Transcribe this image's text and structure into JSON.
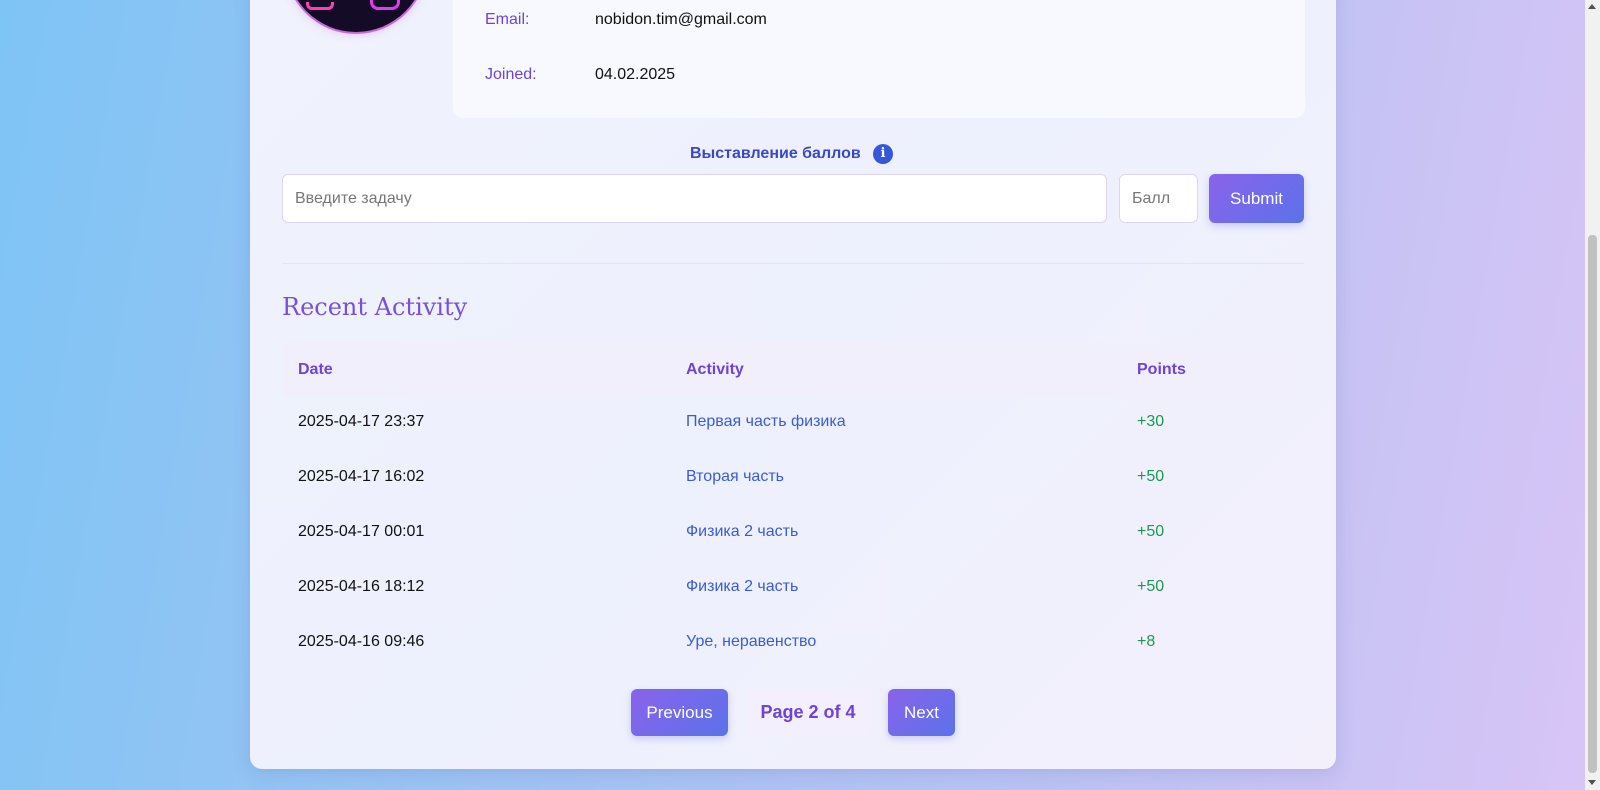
{
  "profile": {
    "email_label": "Email:",
    "email_value": "nobidon.tim@gmail.com",
    "joined_label": "Joined:",
    "joined_value": "04.02.2025"
  },
  "scoring": {
    "title": "Выставление баллов",
    "info_icon": "info-icon",
    "task_placeholder": "Введите задачу",
    "points_placeholder": "Балл",
    "submit_label": "Submit"
  },
  "activity": {
    "title": "Recent Activity",
    "columns": [
      "Date",
      "Activity",
      "Points"
    ],
    "rows": [
      {
        "date": "2025-04-17 23:37",
        "activity": "Первая часть физика",
        "points": "+30"
      },
      {
        "date": "2025-04-17 16:02",
        "activity": "Вторая часть",
        "points": "+50"
      },
      {
        "date": "2025-04-17 00:01",
        "activity": "Физика 2 часть",
        "points": "+50"
      },
      {
        "date": "2025-04-16 18:12",
        "activity": "Физика 2 часть",
        "points": "+50"
      },
      {
        "date": "2025-04-16 09:46",
        "activity": "Уре, неравенство",
        "points": "+8"
      }
    ]
  },
  "pagination": {
    "previous_label": "Previous",
    "page_info": "Page 2 of 4",
    "next_label": "Next"
  },
  "colors": {
    "accent": "#6d43d9",
    "link": "#3b5bd6",
    "positive": "#1a9a4e"
  }
}
